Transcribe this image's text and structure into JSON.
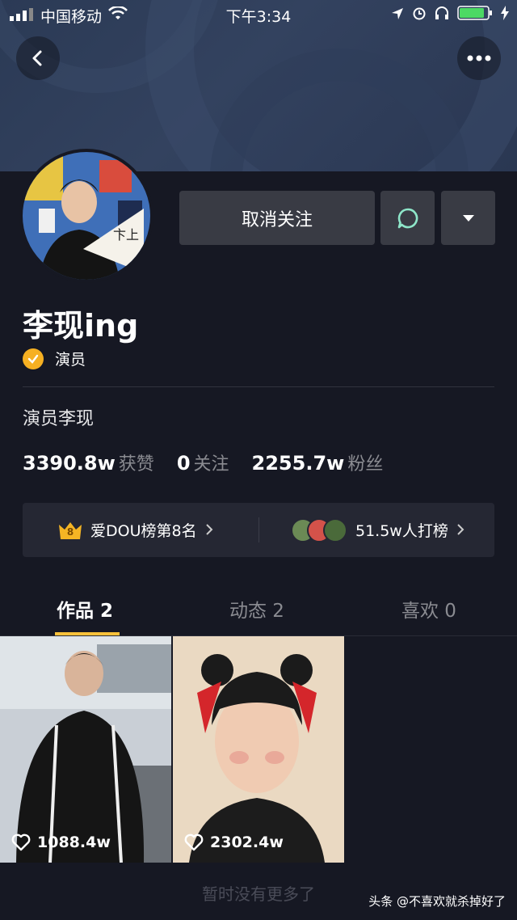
{
  "status_bar": {
    "carrier": "中国移动",
    "time": "下午3:34",
    "battery_color": "#4cd964"
  },
  "profile": {
    "unfollow_label": "取消关注",
    "nickname": "李现ing",
    "verified_label": "演员",
    "bio": "演员李现",
    "stats": [
      {
        "value": "3390.8w",
        "label": "获赞"
      },
      {
        "value": "0",
        "label": "关注"
      },
      {
        "value": "2255.7w",
        "label": "粉丝"
      }
    ],
    "rank_badge": "8",
    "rank_text": "爱DOU榜第8名",
    "supporters_text": "51.5w人打榜"
  },
  "tabs": [
    {
      "label": "作品 2",
      "active": true
    },
    {
      "label": "动态 2",
      "active": false
    },
    {
      "label": "喜欢 0",
      "active": false
    }
  ],
  "videos": [
    {
      "likes": "1088.4w"
    },
    {
      "likes": "2302.4w"
    }
  ],
  "footer_text": "暂时没有更多了",
  "watermark": "头条 @不喜欢就杀掉好了",
  "colors": {
    "background": "#161823",
    "accent_yellow": "#f8c13a",
    "message_icon": "#8ee6c9"
  }
}
